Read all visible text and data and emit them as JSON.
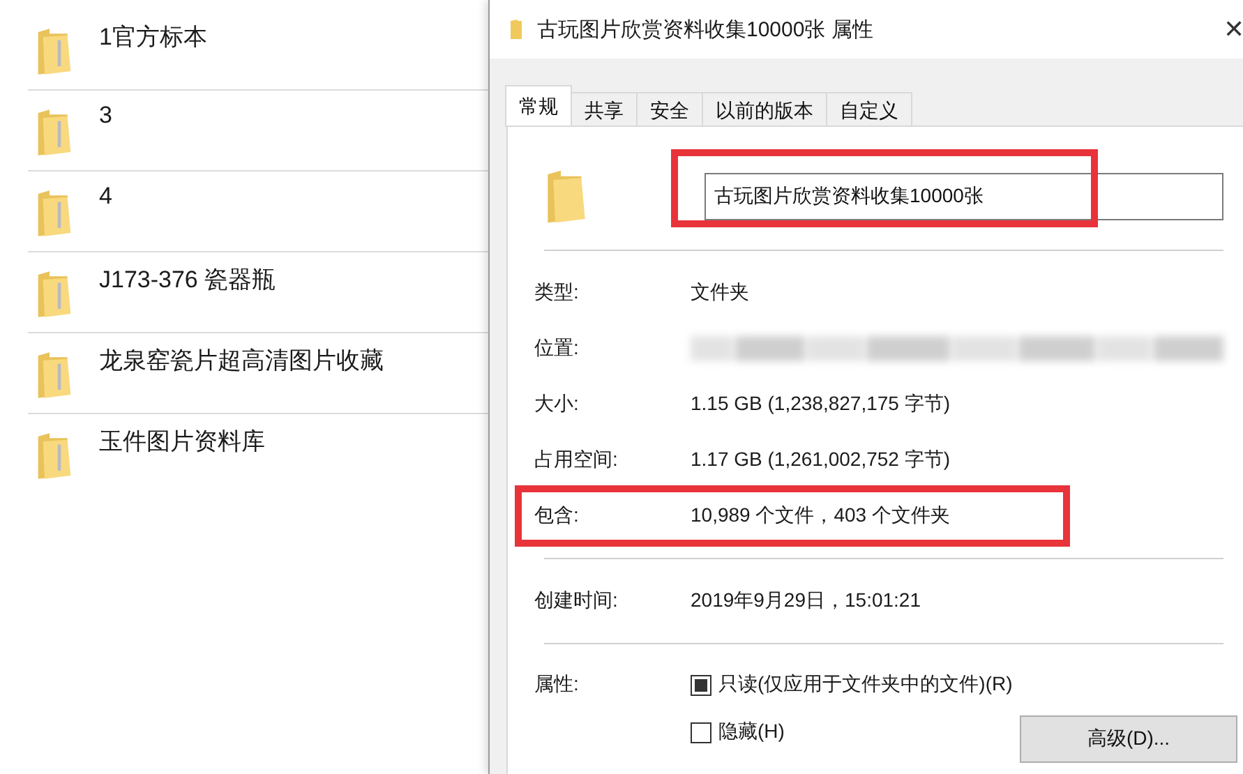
{
  "folders": [
    {
      "name": "1官方标本"
    },
    {
      "name": "3"
    },
    {
      "name": "4"
    },
    {
      "name": "J173-376 瓷器瓶"
    },
    {
      "name": "龙泉窑瓷片超高清图片收藏"
    },
    {
      "name": "玉件图片资料库"
    }
  ],
  "dialog": {
    "title": "古玩图片欣赏资料收集10000张 属性",
    "close": "✕",
    "tabs": [
      {
        "label": "常规",
        "selected": true
      },
      {
        "label": "共享",
        "selected": false
      },
      {
        "label": "安全",
        "selected": false
      },
      {
        "label": "以前的版本",
        "selected": false
      },
      {
        "label": "自定义",
        "selected": false
      }
    ],
    "name_field": {
      "value": "古玩图片欣赏资料收集10000张",
      "highlighted": true
    },
    "sections": [
      {
        "rows": [
          {
            "label": "类型:",
            "kind": "text",
            "value": "文件夹",
            "highlighted": false
          },
          {
            "label": "位置:",
            "kind": "blurred",
            "highlighted": false
          },
          {
            "label": "大小:",
            "kind": "text",
            "value": "1.15 GB (1,238,827,175 字节)",
            "highlighted": false
          },
          {
            "label": "占用空间:",
            "kind": "text",
            "value": "1.17 GB (1,261,002,752 字节)",
            "highlighted": false
          },
          {
            "label": "包含:",
            "kind": "text",
            "value": "10,989 个文件，403 个文件夹",
            "highlighted": true
          }
        ]
      },
      {
        "rows": [
          {
            "label": "创建时间:",
            "kind": "text",
            "value": "2019年9月29日，15:01:21",
            "highlighted": false
          }
        ]
      }
    ],
    "attributes": {
      "label": "属性:",
      "options": [
        {
          "label": "只读(仅应用于文件夹中的文件)(R)",
          "checked": true
        },
        {
          "label": "隐藏(H)",
          "checked": false
        }
      ]
    },
    "advanced_button": "高级(D)..."
  }
}
